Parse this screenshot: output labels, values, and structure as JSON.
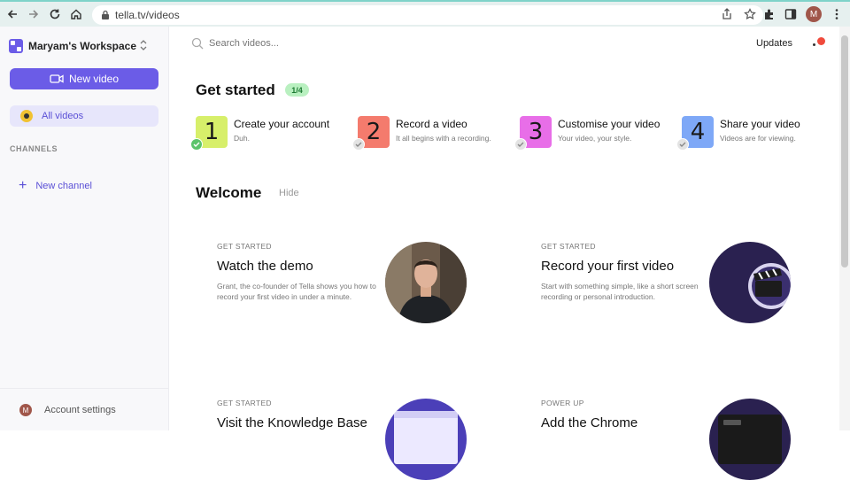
{
  "browser": {
    "url": "tella.tv/videos",
    "profile_initial": "M"
  },
  "sidebar": {
    "workspace_name": "Maryam's Workspace",
    "new_video_label": "New video",
    "all_videos_label": "All videos",
    "channels_heading": "CHANNELS",
    "new_channel_label": "New channel",
    "account_initial": "M",
    "account_label": "Account settings"
  },
  "header": {
    "search_placeholder": "Search videos...",
    "updates_label": "Updates"
  },
  "get_started": {
    "heading": "Get started",
    "progress": "1/4",
    "steps": [
      {
        "number": "1",
        "title": "Create your account",
        "subtitle": "Duh.",
        "done": true,
        "color": "#d7ef6a"
      },
      {
        "number": "2",
        "title": "Record a video",
        "subtitle": "It all begins with a recording.",
        "done": false,
        "color": "#f47b6d"
      },
      {
        "number": "3",
        "title": "Customise your video",
        "subtitle": "Your video, your style.",
        "done": false,
        "color": "#e86ee8"
      },
      {
        "number": "4",
        "title": "Share your video",
        "subtitle": "Videos are for viewing.",
        "done": false,
        "color": "#7ea8f7"
      }
    ]
  },
  "welcome": {
    "heading": "Welcome",
    "hide_label": "Hide",
    "cards": [
      {
        "kicker": "GET STARTED",
        "title": "Watch the demo",
        "description": "Grant, the co-founder of Tella shows you how to record your first video in under a minute."
      },
      {
        "kicker": "GET STARTED",
        "title": "Record your first video",
        "description": "Start with something simple, like a short screen recording or personal introduction."
      },
      {
        "kicker": "GET STARTED",
        "title": "Visit the Knowledge Base",
        "description": ""
      },
      {
        "kicker": "POWER UP",
        "title": "Add the Chrome",
        "description": ""
      }
    ]
  },
  "colors": {
    "accent": "#6b5ce7",
    "accent_light": "#e7e6fb",
    "badge_green_bg": "#b9f0c0",
    "badge_green_text": "#1c7a32",
    "notification_red": "#f04a3c"
  }
}
